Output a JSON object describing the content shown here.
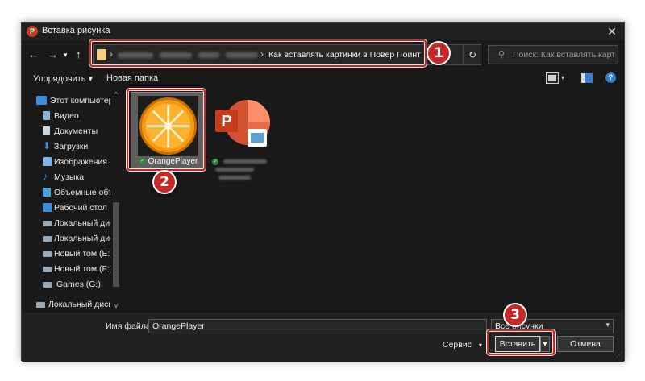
{
  "window": {
    "title": "Вставка рисунка",
    "app_icon_letter": "P",
    "close_glyph": "✕"
  },
  "address": {
    "current_folder": "Как вставлять картинки в Повер Поинт",
    "search_placeholder": "Поиск: Как вставлять карти..."
  },
  "toolbar": {
    "organize": "Упорядочить ▾",
    "new_folder": "Новая папка"
  },
  "sidebar": {
    "items": [
      {
        "label": "Этот компьютер",
        "icon": "computer-icon",
        "color": "#3b8fd9"
      },
      {
        "label": "Видео",
        "icon": "video-icon",
        "color": "#8ab4d9"
      },
      {
        "label": "Документы",
        "icon": "documents-icon",
        "color": "#c9d6e3"
      },
      {
        "label": "Загрузки",
        "icon": "downloads-icon",
        "color": "#3b8fd9"
      },
      {
        "label": "Изображения",
        "icon": "pictures-icon",
        "color": "#7fb2e5"
      },
      {
        "label": "Музыка",
        "icon": "music-icon",
        "color": "#3b8fd9"
      },
      {
        "label": "Объемные объ",
        "icon": "3d-objects-icon",
        "color": "#4aa3e0"
      },
      {
        "label": "Рабочий стол",
        "icon": "desktop-icon",
        "color": "#3b8fd9"
      },
      {
        "label": "Локальный дис",
        "icon": "drive-icon",
        "color": "#9aa7b4"
      },
      {
        "label": "Локальный дис",
        "icon": "drive-icon",
        "color": "#9aa7b4"
      },
      {
        "label": "Новый том (E:)",
        "icon": "drive-icon",
        "color": "#9aa7b4"
      },
      {
        "label": "Новый том (F:)",
        "icon": "drive-icon",
        "color": "#9aa7b4"
      },
      {
        "label": "Games (G:)",
        "icon": "drive-icon",
        "color": "#9aa7b4"
      },
      {
        "label": "Локальный диск",
        "icon": "drive-icon",
        "color": "#9aa7b4"
      }
    ]
  },
  "files": [
    {
      "name": "OrangePlayer",
      "type": "image",
      "selected": true
    },
    {
      "name": "",
      "type": "powerpoint",
      "selected": false
    }
  ],
  "bottom": {
    "filename_label": "Имя файла:",
    "filename_value": "OrangePlayer",
    "filter_value": "Все рисунки",
    "tools_label": "Сервис",
    "insert_label": "Вставить",
    "cancel_label": "Отмена"
  },
  "annotations": {
    "badge1": "1",
    "badge2": "2",
    "badge3": "3",
    "color": "#c62828"
  },
  "colors": {
    "window_bg": "#191919",
    "orange": "#f39c12",
    "powerpoint": "#c43e1c"
  }
}
